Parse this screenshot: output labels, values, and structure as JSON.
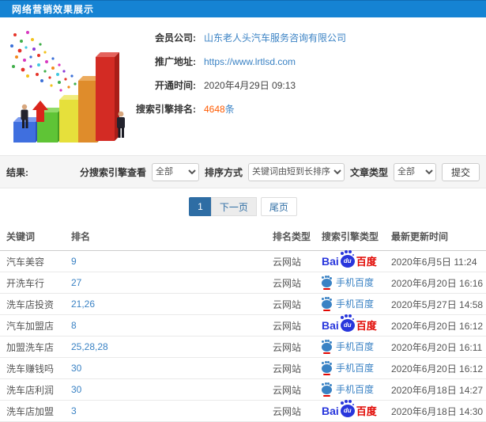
{
  "title": "网络营销效果展示",
  "info": {
    "rows": [
      {
        "label": "会员公司:",
        "value": "山东老人头汽车服务咨询有限公司",
        "style": "link",
        "name": "member-company"
      },
      {
        "label": "推广地址:",
        "value": "https://www.lrtlsd.com",
        "style": "link",
        "name": "promo-url"
      },
      {
        "label": "开通时间:",
        "value": "2020年4月29日 09:13",
        "style": "plain",
        "name": "open-time"
      },
      {
        "label": "搜索引擎排名:",
        "number": "4648",
        "unit": "条",
        "style": "count",
        "name": "engine-rank-count"
      }
    ]
  },
  "filters": {
    "result_label": "结果:",
    "engine_view_label": "分搜索引擎查看",
    "engine_view_value": "全部",
    "sort_label": "排序方式",
    "sort_value": "关键词由短到长排序",
    "article_type_label": "文章类型",
    "article_type_value": "全部",
    "submit_label": "提交"
  },
  "pagination": {
    "current": "1",
    "next_label": "下一页",
    "last_label": "尾页"
  },
  "table": {
    "headers": [
      "关键词",
      "排名",
      "排名类型",
      "搜索引擎类型",
      "最新更新时间"
    ],
    "rows": [
      {
        "keyword": "汽车美容",
        "rank": "9",
        "rank_type": "云网站",
        "engine": "baidu",
        "updated": "2020年6月5日 11:24"
      },
      {
        "keyword": "开洗车行",
        "rank": "27",
        "rank_type": "云网站",
        "engine": "mobile_baidu",
        "updated": "2020年6月20日 16:16"
      },
      {
        "keyword": "洗车店投资",
        "rank": "21,26",
        "rank_type": "云网站",
        "engine": "mobile_baidu",
        "updated": "2020年5月27日 14:58"
      },
      {
        "keyword": "汽车加盟店",
        "rank": "8",
        "rank_type": "云网站",
        "engine": "baidu",
        "updated": "2020年6月20日 16:12"
      },
      {
        "keyword": "加盟洗车店",
        "rank": "25,28,28",
        "rank_type": "云网站",
        "engine": "mobile_baidu",
        "updated": "2020年6月20日 16:11"
      },
      {
        "keyword": "洗车赚钱吗",
        "rank": "30",
        "rank_type": "云网站",
        "engine": "mobile_baidu",
        "updated": "2020年6月20日 16:12"
      },
      {
        "keyword": "洗车店利润",
        "rank": "30",
        "rank_type": "云网站",
        "engine": "mobile_baidu",
        "updated": "2020年6月18日 14:27"
      },
      {
        "keyword": "洗车店加盟",
        "rank": "3",
        "rank_type": "云网站",
        "engine": "baidu",
        "updated": "2020年6月18日 14:30"
      }
    ]
  },
  "engine_logos": {
    "baidu": {
      "bai": "Bai",
      "du": "du",
      "cn": "百度"
    },
    "mobile_baidu": {
      "label": "手机百度"
    }
  },
  "colors": {
    "topbar": "#1583d3",
    "link": "#3a82c4",
    "count_number": "#ff5a00",
    "pagination_active": "#2e6da4",
    "baidu_blue": "#2836dc",
    "baidu_red": "#e10601"
  }
}
